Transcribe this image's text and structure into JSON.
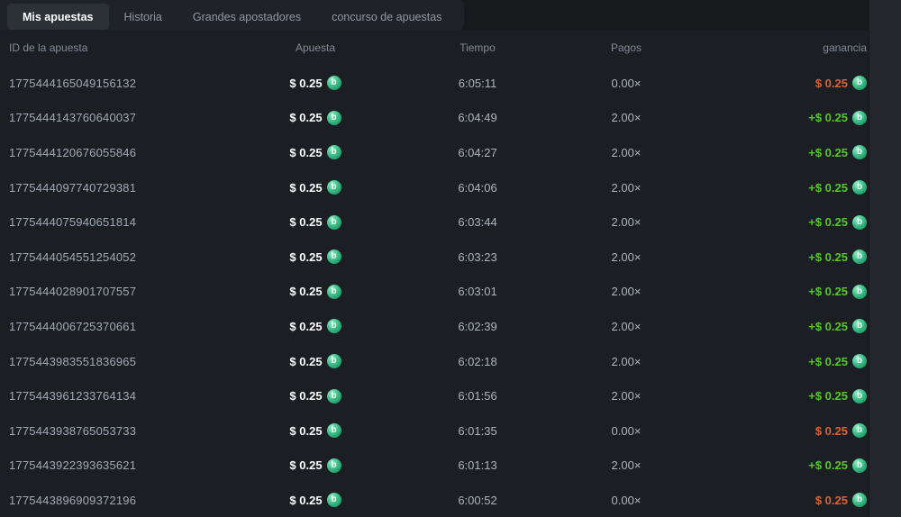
{
  "tabs": [
    {
      "key": "mis-apuestas",
      "label": "Mis apuestas",
      "active": true
    },
    {
      "key": "historia",
      "label": "Historia",
      "active": false
    },
    {
      "key": "grandes-apostadores",
      "label": "Grandes apostadores",
      "active": false
    },
    {
      "key": "concurso-de-apuestas",
      "label": "concurso de apuestas",
      "active": false
    }
  ],
  "table": {
    "headers": {
      "id": "ID de la apuesta",
      "bet": "Apuesta",
      "time": "Tiempo",
      "payout": "Pagos",
      "profit": "ganancia"
    }
  },
  "coin_icon": "b",
  "colors": {
    "profit_win": "#54c824",
    "profit_loss": "#dd6231",
    "coin_green": "#23a06b",
    "background": "#1b1f24"
  },
  "rows": [
    {
      "id": "1775444165049156132",
      "bet": "$ 0.25",
      "time": "6:05:11",
      "payout": "0.00×",
      "profit": "$ 0.25",
      "result": "loss"
    },
    {
      "id": "1775444143760640037",
      "bet": "$ 0.25",
      "time": "6:04:49",
      "payout": "2.00×",
      "profit": "+$ 0.25",
      "result": "win"
    },
    {
      "id": "1775444120676055846",
      "bet": "$ 0.25",
      "time": "6:04:27",
      "payout": "2.00×",
      "profit": "+$ 0.25",
      "result": "win"
    },
    {
      "id": "1775444097740729381",
      "bet": "$ 0.25",
      "time": "6:04:06",
      "payout": "2.00×",
      "profit": "+$ 0.25",
      "result": "win"
    },
    {
      "id": "1775444075940651814",
      "bet": "$ 0.25",
      "time": "6:03:44",
      "payout": "2.00×",
      "profit": "+$ 0.25",
      "result": "win"
    },
    {
      "id": "1775444054551254052",
      "bet": "$ 0.25",
      "time": "6:03:23",
      "payout": "2.00×",
      "profit": "+$ 0.25",
      "result": "win"
    },
    {
      "id": "1775444028901707557",
      "bet": "$ 0.25",
      "time": "6:03:01",
      "payout": "2.00×",
      "profit": "+$ 0.25",
      "result": "win"
    },
    {
      "id": "1775444006725370661",
      "bet": "$ 0.25",
      "time": "6:02:39",
      "payout": "2.00×",
      "profit": "+$ 0.25",
      "result": "win"
    },
    {
      "id": "1775443983551836965",
      "bet": "$ 0.25",
      "time": "6:02:18",
      "payout": "2.00×",
      "profit": "+$ 0.25",
      "result": "win"
    },
    {
      "id": "1775443961233764134",
      "bet": "$ 0.25",
      "time": "6:01:56",
      "payout": "2.00×",
      "profit": "+$ 0.25",
      "result": "win"
    },
    {
      "id": "1775443938765053733",
      "bet": "$ 0.25",
      "time": "6:01:35",
      "payout": "0.00×",
      "profit": "$ 0.25",
      "result": "loss"
    },
    {
      "id": "1775443922393635621",
      "bet": "$ 0.25",
      "time": "6:01:13",
      "payout": "2.00×",
      "profit": "+$ 0.25",
      "result": "win"
    },
    {
      "id": "1775443896909372196",
      "bet": "$ 0.25",
      "time": "6:00:52",
      "payout": "0.00×",
      "profit": "$ 0.25",
      "result": "loss"
    }
  ]
}
